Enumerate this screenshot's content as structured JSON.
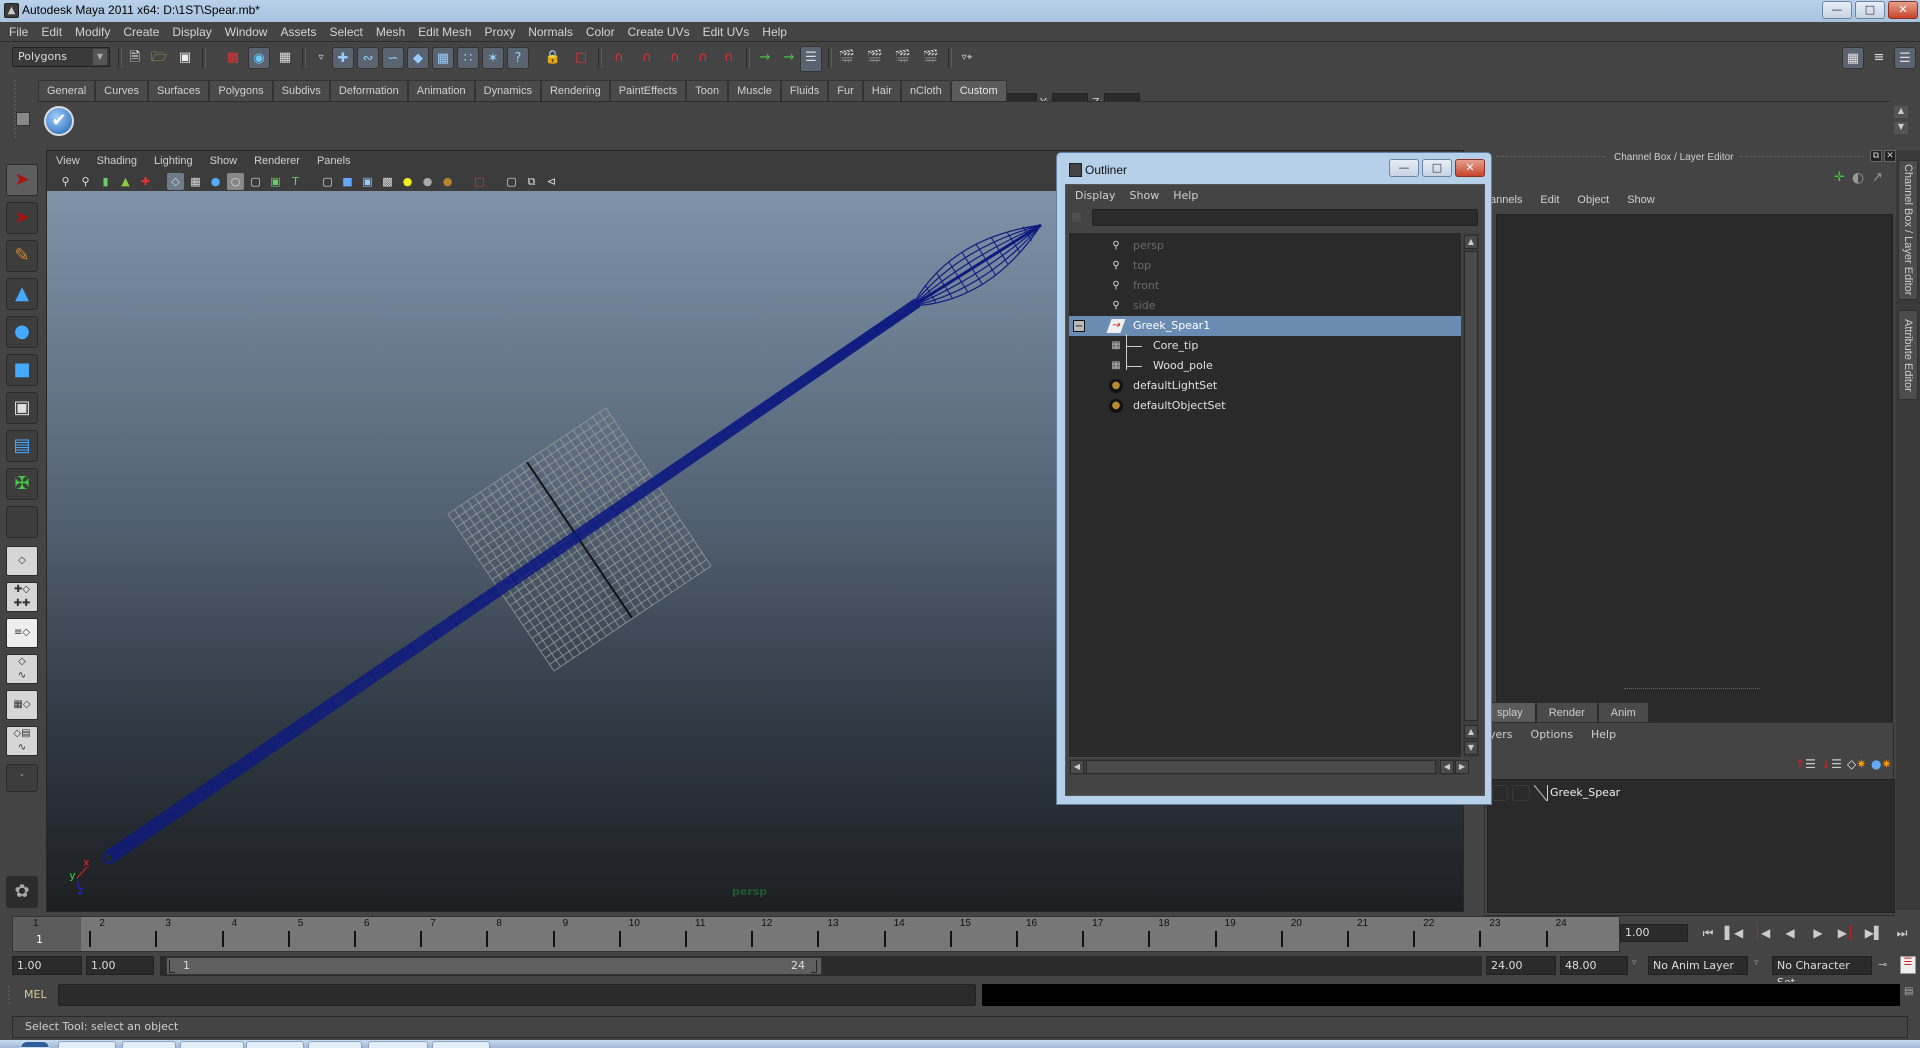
{
  "window": {
    "title": "Autodesk Maya 2011 x64: D:\\1ST\\Spear.mb*",
    "controls": {
      "minimize": "—",
      "maximize": "□",
      "close": "✕"
    }
  },
  "menubar": [
    "File",
    "Edit",
    "Modify",
    "Create",
    "Display",
    "Window",
    "Assets",
    "Select",
    "Mesh",
    "Edit Mesh",
    "Proxy",
    "Normals",
    "Color",
    "Create UVs",
    "Edit UVs",
    "Help"
  ],
  "statusline": {
    "menu_set": "Polygons",
    "coord_labels": {
      "x": "X:",
      "y": "Y:",
      "z": "Z:"
    },
    "coord_values": {
      "x": "",
      "y": "",
      "z": ""
    },
    "icons": [
      "new-scene-icon",
      "open-scene-icon",
      "save-scene-icon",
      "select-by-hierarchy-icon",
      "select-by-object-icon",
      "select-by-component-icon",
      "mask-icon",
      "select-handles-icon",
      "select-joints-icon",
      "select-curves-icon",
      "select-surfaces-icon",
      "select-deformations-icon",
      "select-dynamics-icon",
      "select-rendering-icon",
      "select-misc-icon",
      "lock-selection-icon",
      "highlight-selection-icon",
      "snap-grid-icon",
      "snap-curve-icon",
      "snap-point-icon",
      "snap-view-plane-icon",
      "snap-live-icon",
      "input-ops-icon",
      "output-ops-icon",
      "construction-history-icon",
      "render-view-icon",
      "render-current-icon",
      "ipr-render-icon",
      "render-settings-icon",
      "input-line-menu-icon"
    ]
  },
  "shelf": {
    "tabs": [
      "General",
      "Curves",
      "Surfaces",
      "Polygons",
      "Subdivs",
      "Deformation",
      "Animation",
      "Dynamics",
      "Rendering",
      "PaintEffects",
      "Toon",
      "Muscle",
      "Fluids",
      "Fur",
      "Hair",
      "nCloth",
      "Custom"
    ],
    "active_tab": "Custom",
    "items": [
      "checkmark-icon"
    ]
  },
  "toolbox": {
    "tools": [
      {
        "name": "select-tool",
        "glyph": "➤"
      },
      {
        "name": "lasso-tool",
        "glyph": "⬚"
      },
      {
        "name": "paint-select-tool",
        "glyph": "✎"
      },
      {
        "name": "move-tool",
        "glyph": "▲"
      },
      {
        "name": "rotate-tool",
        "glyph": "●"
      },
      {
        "name": "scale-tool",
        "glyph": "■"
      },
      {
        "name": "universal-manipulator",
        "glyph": "▣"
      },
      {
        "name": "soft-modification-tool",
        "glyph": "▤"
      },
      {
        "name": "show-manipulator-tool",
        "glyph": "✠"
      },
      {
        "name": "last-used-tool",
        "glyph": ""
      }
    ],
    "layouts": [
      "single-perspective-layout",
      "four-view-layout",
      "persp-outliner-layout",
      "persp-graph-layout",
      "hypershade-persp-layout",
      "persp-graph-hypergraph-layout"
    ],
    "more_label": "ˇ"
  },
  "viewport": {
    "menu": [
      "View",
      "Shading",
      "Lighting",
      "Show",
      "Renderer",
      "Panels"
    ],
    "icons": [
      "select-camera-icon",
      "camera-attributes-icon",
      "bookmarks-icon",
      "image-plane-icon",
      "2d-pan-zoom-icon",
      "grid-icon",
      "film-gate-icon",
      "resolution-gate-icon",
      "gate-mask-icon",
      "field-chart-icon",
      "safe-action-icon",
      "safe-title-icon",
      "wireframe-icon",
      "smooth-shade-icon",
      "wireframe-on-shaded-icon",
      "textured-icon",
      "default-lighting-icon",
      "all-lights-icon",
      "shadows-icon",
      "isolate-select-icon",
      "xray-icon",
      "xray-joints-icon",
      "component-xray-icon"
    ],
    "camera_label": "persp",
    "axis_labels": {
      "x": "x",
      "y": "y",
      "z": "z"
    },
    "wire_color": "#0d1a80"
  },
  "outliner": {
    "title": "Outliner",
    "menu": [
      "Display",
      "Show",
      "Help"
    ],
    "filter_value": "",
    "items": [
      {
        "label": "persp",
        "icon": "camera-icon",
        "dim": true,
        "depth": 0
      },
      {
        "label": "top",
        "icon": "camera-icon",
        "dim": true,
        "depth": 0
      },
      {
        "label": "front",
        "icon": "camera-icon",
        "dim": true,
        "depth": 0
      },
      {
        "label": "side",
        "icon": "camera-icon",
        "dim": true,
        "depth": 0
      },
      {
        "label": "Greek_Spear1",
        "icon": "group-icon",
        "dim": false,
        "depth": 0,
        "selected": true,
        "expanded": true
      },
      {
        "label": "Core_tip",
        "icon": "mesh-icon",
        "dim": false,
        "depth": 1
      },
      {
        "label": "Wood_pole",
        "icon": "mesh-icon",
        "dim": false,
        "depth": 1
      },
      {
        "label": "defaultLightSet",
        "icon": "set-icon",
        "dim": false,
        "depth": 0
      },
      {
        "label": "defaultObjectSet",
        "icon": "set-icon",
        "dim": false,
        "depth": 0
      }
    ],
    "collapse_glyph": "−"
  },
  "channelbox": {
    "title": "Channel Box / Layer Editor",
    "menu": [
      "annels",
      "Edit",
      "Object",
      "Show"
    ],
    "layer_tabs": [
      "splay",
      "Render",
      "Anim"
    ],
    "active_layer_tab": "splay",
    "layer_menu": [
      "yers",
      "Options",
      "Help"
    ],
    "layers": [
      {
        "name": "Greek_Spear"
      }
    ],
    "side_tabs": [
      "Channel Box / Layer Editor",
      "Attribute Editor"
    ]
  },
  "timeslider": {
    "start": 1,
    "end": 24,
    "ticks": [
      1,
      2,
      3,
      4,
      5,
      6,
      7,
      8,
      9,
      10,
      11,
      12,
      13,
      14,
      15,
      16,
      17,
      18,
      19,
      20,
      21,
      22,
      23,
      24
    ],
    "current_frame": 1,
    "current_frame_label": "1",
    "current_time_field": "1.00"
  },
  "playback": {
    "buttons": [
      {
        "name": "go-to-start-button",
        "glyph": "⏮"
      },
      {
        "name": "step-back-frame-button",
        "glyph": "⏴❙"
      },
      {
        "name": "step-back-key-button",
        "glyph": "❙◀"
      },
      {
        "name": "play-backwards-button",
        "glyph": "◀"
      },
      {
        "name": "play-forwards-button",
        "glyph": "▶"
      },
      {
        "name": "step-forward-key-button",
        "glyph": "▶❙"
      },
      {
        "name": "step-forward-frame-button",
        "glyph": "▶❙"
      },
      {
        "name": "go-to-end-button",
        "glyph": "⏭"
      }
    ]
  },
  "range": {
    "anim_start": "1.00",
    "playback_start": "1.00",
    "slider_start_label": "1",
    "slider_end_label": "24",
    "playback_end": "24.00",
    "anim_end": "48.00",
    "anim_layer": "No Anim Layer",
    "character_set": "No Character Set"
  },
  "commandline": {
    "label": "MEL",
    "input_value": "",
    "result": ""
  },
  "helpline": {
    "text": "Select Tool: select an object"
  }
}
